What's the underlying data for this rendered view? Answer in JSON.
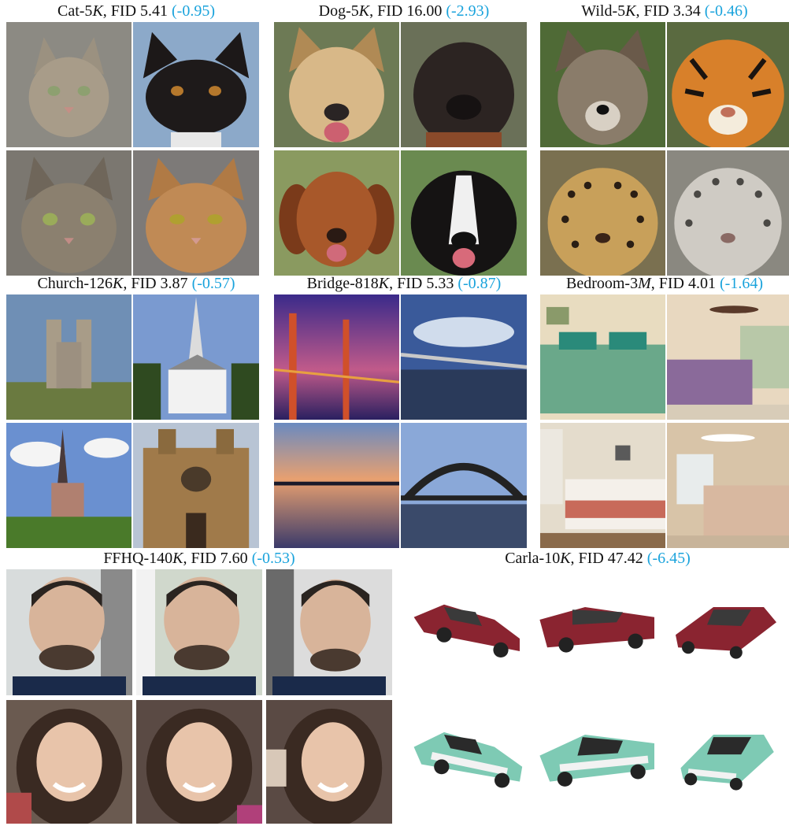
{
  "panels": [
    {
      "id": "cat",
      "name": "Cat-5",
      "scale": "K",
      "metric": "FID 5.41",
      "delta": "(-0.95)",
      "images": [
        "tabby-cat",
        "black-white-cat",
        "tabby-cat-2",
        "orange-tabby-cat"
      ]
    },
    {
      "id": "dog",
      "name": "Dog-5",
      "scale": "K",
      "metric": "FID 16.00",
      "delta": "(-2.93)",
      "images": [
        "shepherd-dog",
        "boxer-dog",
        "golden-retriever",
        "border-collie"
      ]
    },
    {
      "id": "wild",
      "name": "Wild-5",
      "scale": "K",
      "metric": "FID 3.34",
      "delta": "(-0.46)",
      "images": [
        "wolf",
        "tiger",
        "leopard",
        "snow-leopard"
      ]
    },
    {
      "id": "church",
      "name": "Church-126",
      "scale": "K",
      "metric": "FID 3.87",
      "delta": "(-0.57)",
      "images": [
        "cathedral-twin-towers",
        "white-church-spire",
        "church-spire-town",
        "gothic-cathedral-facade"
      ]
    },
    {
      "id": "bridge",
      "name": "Bridge-818",
      "scale": "K",
      "metric": "FID 5.33",
      "delta": "(-0.87)",
      "images": [
        "golden-gate-bridge",
        "bridge-at-dusk",
        "sunset-long-bridge",
        "arch-bridge"
      ]
    },
    {
      "id": "bedroom",
      "name": "Bedroom-3",
      "scale": "M",
      "metric": "FID 4.01",
      "delta": "(-1.64)",
      "images": [
        "bedroom-green-quilt",
        "bedroom-ceiling-fan",
        "bedroom-white-bed",
        "bedroom-floral-bed"
      ]
    },
    {
      "id": "ffhq",
      "name": "FFHQ-140",
      "scale": "K",
      "metric": "FID 7.60",
      "delta": "(-0.53)",
      "images": [
        "man-front",
        "man-slight-turn",
        "man-side",
        "girl-front",
        "girl-slight-turn",
        "girl-side"
      ]
    },
    {
      "id": "carla",
      "name": "Carla-10",
      "scale": "K",
      "metric": "FID 47.42",
      "delta": "(-6.45)",
      "images": [
        "red-car-view-1",
        "red-car-view-2",
        "red-car-view-3",
        "teal-car-view-1",
        "teal-car-view-2",
        "teal-car-view-3"
      ]
    }
  ]
}
